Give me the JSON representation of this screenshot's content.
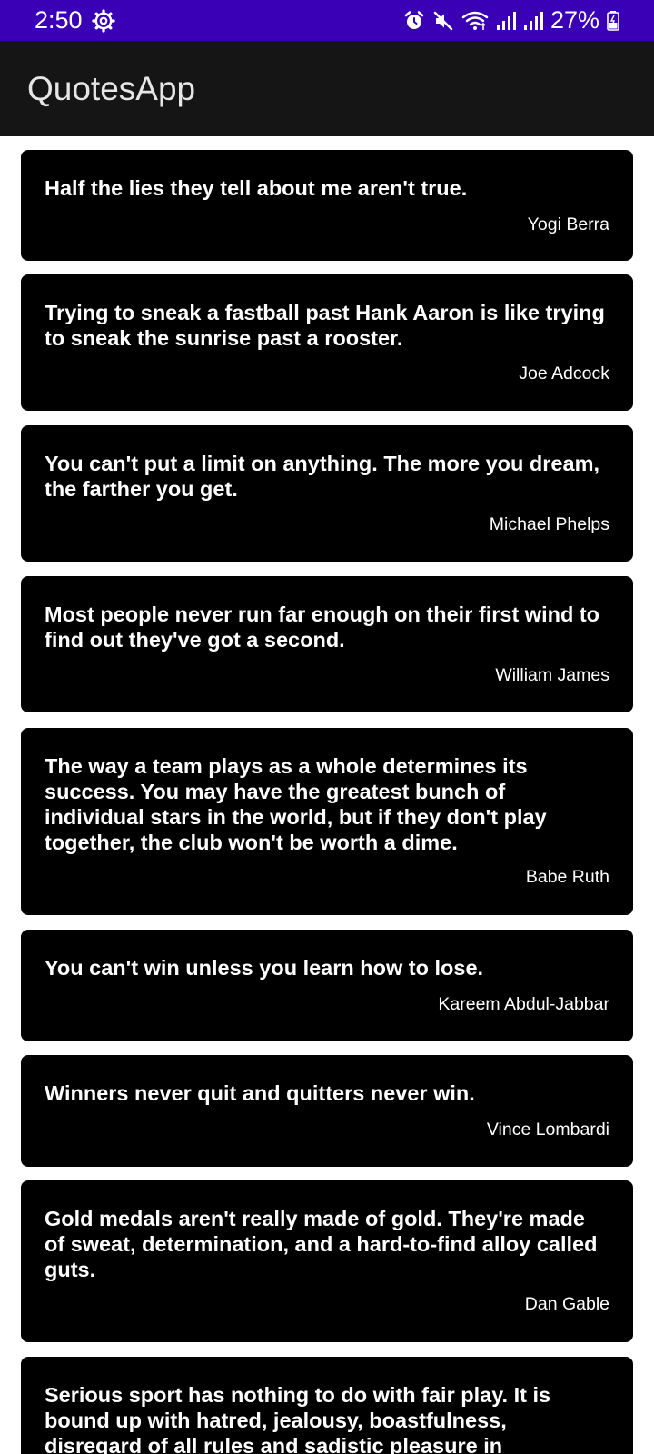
{
  "status_bar": {
    "time": "2:50",
    "battery": "27%",
    "icons": [
      "settings-gear-icon",
      "alarm-icon",
      "mute-icon",
      "wifi-icon",
      "signal-icon",
      "signal-icon",
      "battery-icon"
    ]
  },
  "app_bar": {
    "title": "QuotesApp"
  },
  "quotes": [
    {
      "text": "Half the lies they tell about me aren't true.",
      "author": "Yogi Berra"
    },
    {
      "text": "Trying to sneak a fastball past Hank Aaron is like trying to sneak the sunrise past a rooster.",
      "author": "Joe Adcock"
    },
    {
      "text": "You can't put a limit on anything. The more you dream, the farther you get.",
      "author": "Michael Phelps"
    },
    {
      "text": "Most people never run far enough on their first wind to find out they've got a second.",
      "author": "William James"
    },
    {
      "text": "The way a team plays as a whole determines its success. You may have the greatest bunch of individual stars in the world, but if they don't play together, the club won't be worth a dime.",
      "author": "Babe Ruth"
    },
    {
      "text": "You can't win unless you learn how to lose.",
      "author": "Kareem Abdul-Jabbar"
    },
    {
      "text": "Winners never quit and quitters never win.",
      "author": "Vince Lombardi"
    },
    {
      "text": "Gold medals aren't really made of gold. They're made of sweat, determination, and a hard-to-find alloy called guts.",
      "author": "Dan Gable"
    },
    {
      "text": "Serious sport has nothing to do with fair play. It is bound up with hatred, jealousy, boastfulness, disregard of all rules and sadistic pleasure in witnessing violence. In",
      "author": ""
    }
  ]
}
